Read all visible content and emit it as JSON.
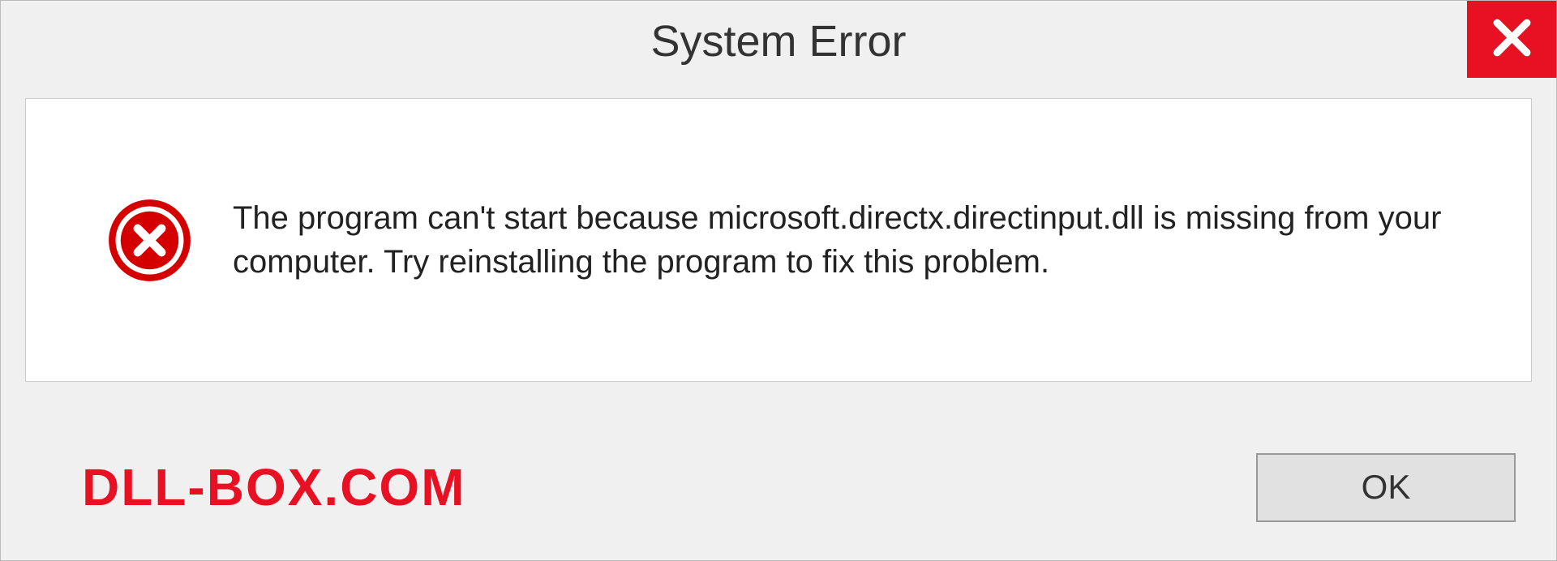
{
  "dialog": {
    "title": "System Error",
    "message": "The program can't start because microsoft.directx.directinput.dll is missing from your computer. Try reinstalling the program to fix this problem.",
    "ok_label": "OK"
  },
  "watermark": "DLL-BOX.COM",
  "colors": {
    "accent_red": "#e81123",
    "background": "#f0f0f0"
  }
}
